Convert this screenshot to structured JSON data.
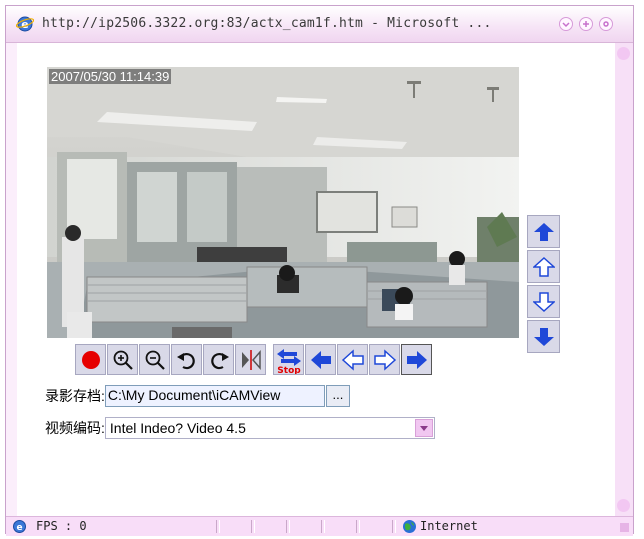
{
  "window": {
    "title": "http://ip2506.3322.org:83/actx_cam1f.htm - Microsoft ...",
    "controls": [
      "minimize",
      "maximize",
      "close"
    ]
  },
  "video": {
    "timestamp": "2007/05/30 11:14:39"
  },
  "ptz": {
    "vertical": [
      "up-solid",
      "up-outline",
      "down-outline",
      "down-solid"
    ]
  },
  "toolbar": {
    "buttons": [
      "record",
      "zoom-in",
      "zoom-out",
      "rotate-left",
      "rotate-right",
      "mirror",
      "stop",
      "left-solid",
      "left-outline",
      "right-outline",
      "right-solid"
    ],
    "stop_label": "Stop"
  },
  "record_path": {
    "label": "录影存档:",
    "value": "C:\\My Document\\iCAMView",
    "browse_label": "..."
  },
  "codec": {
    "label": "视频编码:",
    "value": "Intel Indeo? Video 4.5"
  },
  "statusbar": {
    "text": "FPS : 0",
    "zone": "Internet"
  },
  "colors": {
    "chrome": "#f8ddf8",
    "arrow_blue": "#1f48d8",
    "record_red": "#e60000"
  }
}
